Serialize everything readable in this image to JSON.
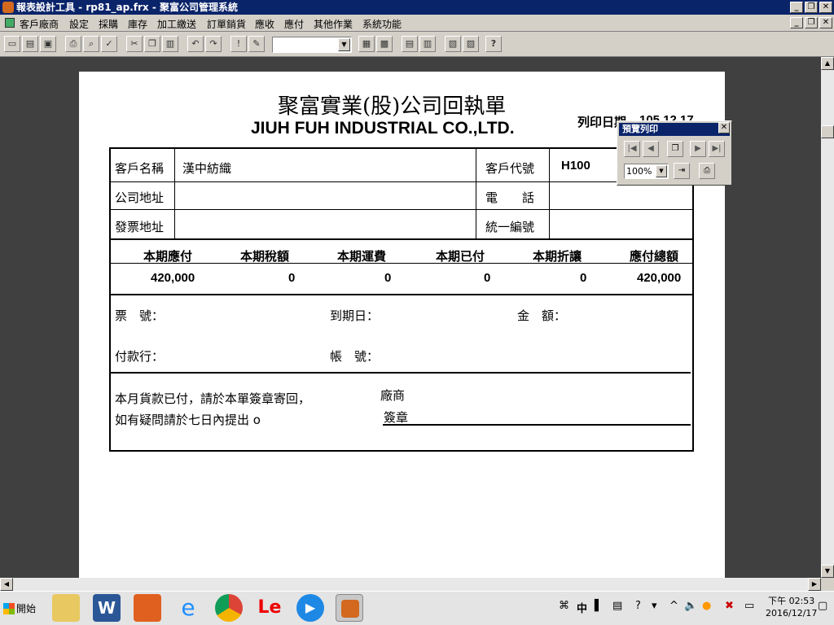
{
  "window": {
    "title": "報表設計工具 - rp81_ap.frx - 聚富公司管理系統"
  },
  "menu": [
    "客戶廠商",
    "設定",
    "採購",
    "庫存",
    "加工繳送",
    "訂單銷貨",
    "應收",
    "應付",
    "其他作業",
    "系統功能"
  ],
  "toolbar": {
    "icons": [
      "new-icon",
      "open-icon",
      "save-icon",
      "print-icon",
      "print-preview-icon",
      "spellcheck-icon",
      "cut-icon",
      "copy-icon",
      "paste-icon",
      "undo-icon",
      "redo-icon",
      "exclamation-icon",
      "edit-icon",
      "form-icon",
      "grid-icon",
      "table-icon",
      "database-icon",
      "properties-icon",
      "report-icon",
      "help-icon"
    ],
    "combo_value": ""
  },
  "report": {
    "title_cn": "聚富實業(股)公司回執單",
    "title_en": "JIUH FUH INDUSTRIAL CO.,LTD.",
    "print_date_label": "列印日期",
    "print_date_value": "105.12.17",
    "customer_name_label": "客戶名稱",
    "customer_name": "漢中紡織",
    "customer_code_label": "客戶代號",
    "customer_code": "H100",
    "company_address_label": "公司地址",
    "phone_label": "電　　話",
    "invoice_address_label": "發票地址",
    "tax_id_label": "統一編號",
    "summary_headers": [
      "本期應付",
      "本期稅額",
      "本期運費",
      "本期已付",
      "本期折讓",
      "應付總額"
    ],
    "summary_values": [
      "420,000",
      "0",
      "0",
      "0",
      "0",
      "420,000"
    ],
    "ticket_no_label": "票　號：",
    "due_date_label": "到期日：",
    "amount_label": "金　額：",
    "bank_label": "付款行：",
    "account_label": "帳　號：",
    "note_line1": "本月貨款已付，請於本單簽章寄回，",
    "note_line2": "如有疑問請於七日內提出 o",
    "vendor_label": "廠商",
    "sign_label": "簽章"
  },
  "preview_toolbar": {
    "title": "預覽列印",
    "zoom": "100%"
  },
  "taskbar": {
    "start": "開始",
    "ime": "中",
    "clock_time": "下午 02:53",
    "clock_date": "2016/12/17"
  }
}
